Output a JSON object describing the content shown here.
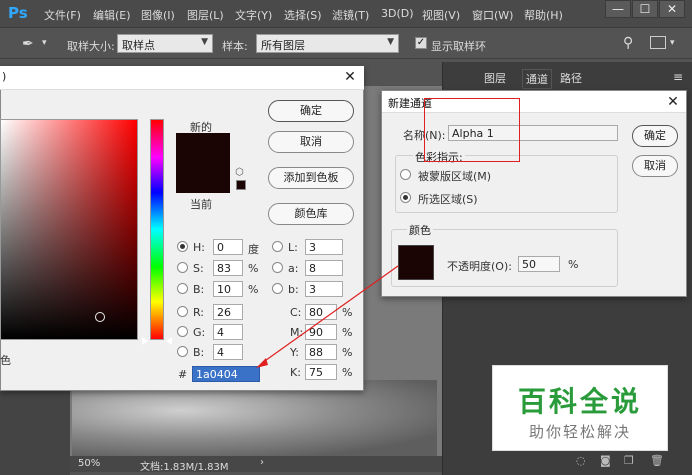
{
  "app": {
    "logo": "Ps"
  },
  "menu": [
    "文件(F)",
    "编辑(E)",
    "图像(I)",
    "图层(L)",
    "文字(Y)",
    "选择(S)",
    "滤镜(T)",
    "3D(D)",
    "视图(V)",
    "窗口(W)",
    "帮助(H)"
  ],
  "window_controls": {
    "minimize": "—",
    "maximize": "☐",
    "close": "✕"
  },
  "options_bar": {
    "tool_icon": "eyedropper-icon",
    "sample_size_label": "取样大小:",
    "sample_size_value": "取样点",
    "sample_label": "样本:",
    "sample_value": "所有图层",
    "show_ring_label": "显示取样环",
    "show_ring_checked": true
  },
  "panels": {
    "tabs": [
      "图层",
      "通道",
      "路径"
    ]
  },
  "status": {
    "zoom": "50%",
    "doc_info": "文档:1.83M/1.83M"
  },
  "color_picker": {
    "title_fragment": ")",
    "new_label": "新的",
    "current_label": "当前",
    "buttons": {
      "ok": "确定",
      "cancel": "取消",
      "add_swatch": "添加到色板",
      "libraries": "颜色库"
    },
    "fields": {
      "H": {
        "label": "H:",
        "value": "0",
        "unit": "度"
      },
      "S": {
        "label": "S:",
        "value": "83",
        "unit": "%"
      },
      "Bv": {
        "label": "B:",
        "value": "10",
        "unit": "%"
      },
      "R": {
        "label": "R:",
        "value": "26"
      },
      "G": {
        "label": "G:",
        "value": "4"
      },
      "Bb": {
        "label": "B:",
        "value": "4"
      },
      "L": {
        "label": "L:",
        "value": "3"
      },
      "a": {
        "label": "a:",
        "value": "8"
      },
      "b": {
        "label": "b:",
        "value": "3"
      },
      "C": {
        "label": "C:",
        "value": "80",
        "unit": "%"
      },
      "M": {
        "label": "M:",
        "value": "90",
        "unit": "%"
      },
      "Y": {
        "label": "Y:",
        "value": "88",
        "unit": "%"
      },
      "K": {
        "label": "K:",
        "value": "75",
        "unit": "%"
      }
    },
    "hex_label": "#",
    "hex_value": "1a0404",
    "bottom_left_text": "色",
    "color": "#1a0404"
  },
  "new_channel": {
    "title": "新建通道",
    "name_label": "名称(N):",
    "name_value": "Alpha 1",
    "indicates_label": "色彩指示:",
    "opt_masked": "被蒙版区域(M)",
    "opt_selected": "所选区域(S)",
    "color_group": "颜色",
    "opacity_label": "不透明度(O):",
    "opacity_value": "50",
    "opacity_unit": "%",
    "ok": "确定",
    "cancel": "取消",
    "swatch_color": "#1a0404"
  },
  "watermark": {
    "title": "百科全说",
    "subtitle": "助你轻松解决"
  }
}
